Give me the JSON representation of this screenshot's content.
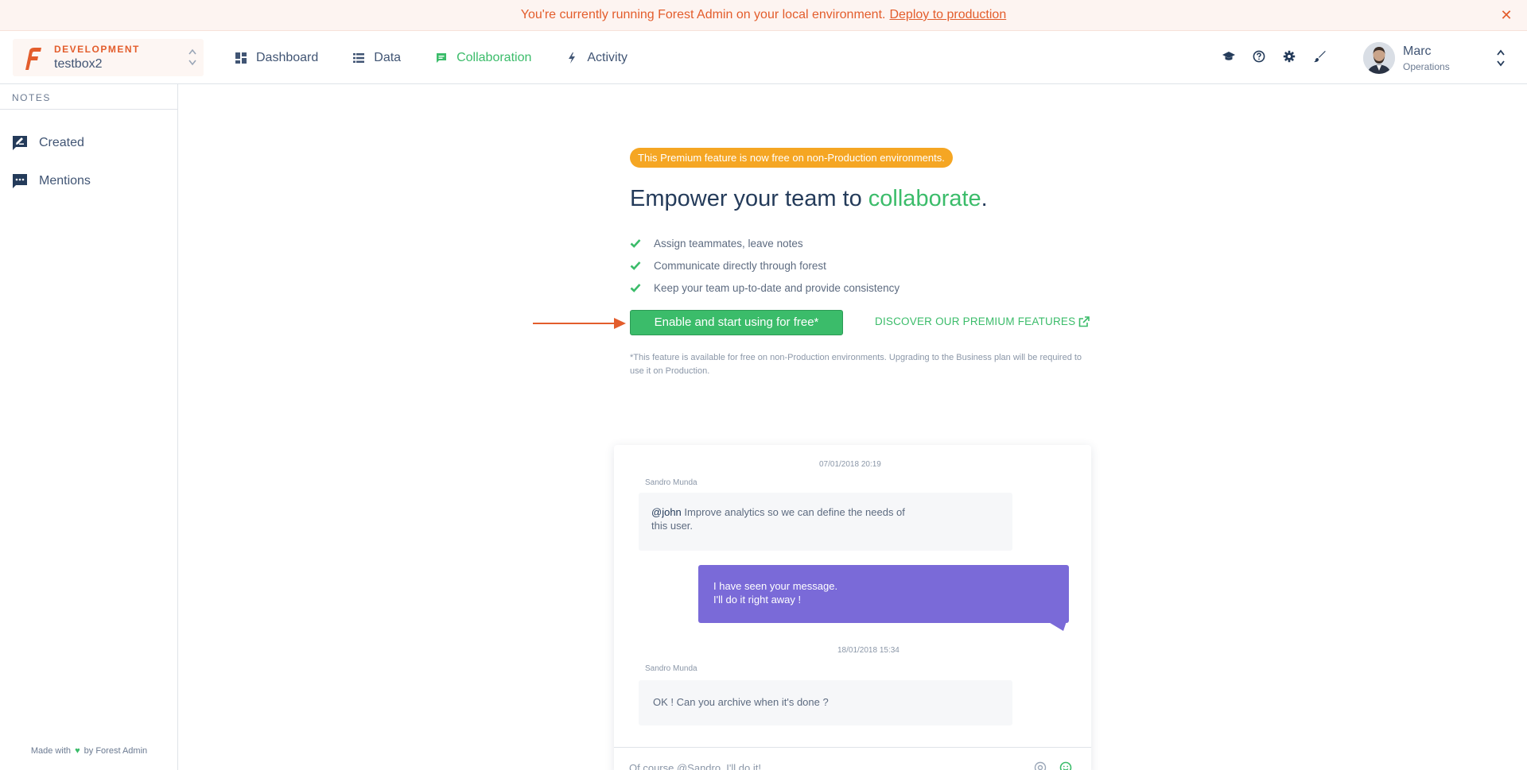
{
  "banner": {
    "message": "You're currently running Forest Admin on your local environment.",
    "link": "Deploy to production",
    "close_glyph": "✕"
  },
  "header": {
    "environment": {
      "label": "DEVELOPMENT",
      "name": "testbox2"
    },
    "nav": [
      {
        "label": "Dashboard",
        "icon": "dashboard-icon"
      },
      {
        "label": "Data",
        "icon": "list-icon"
      },
      {
        "label": "Collaboration",
        "icon": "chat-icon",
        "active": true
      },
      {
        "label": "Activity",
        "icon": "bolt-icon"
      }
    ],
    "tools": [
      "graduation-cap-icon",
      "help-icon",
      "gear-icon",
      "brush-icon"
    ],
    "user": {
      "name": "Marc",
      "role": "Operations"
    }
  },
  "sidebar": {
    "heading": "NOTES",
    "items": [
      {
        "label": "Created",
        "icon": "note-edit-icon"
      },
      {
        "label": "Mentions",
        "icon": "comment-icon"
      }
    ],
    "footer": {
      "prefix": "Made with",
      "suffix": "by Forest Admin"
    }
  },
  "main": {
    "badge": "This Premium feature is now free on non-Production environments.",
    "headline": {
      "before": "Empower your team to",
      "accent": "collaborate",
      "after": "."
    },
    "features": [
      "Assign teammates, leave notes",
      "Communicate directly through forest",
      "Keep your team up-to-date and provide consistency"
    ],
    "cta": "Enable and start using for free*",
    "premium_link": "DISCOVER OUR PREMIUM FEATURES",
    "footnote": "*This feature is available for free on non-Production environments. Upgrading to the Business plan will be required to use it on Production."
  },
  "preview": {
    "thread": [
      {
        "timestamp": "07/01/2018 20:19",
        "author": "Sandro Munda",
        "mention": "@john",
        "text": "Improve analytics so we can define the needs of this user."
      },
      {
        "reply_line1": "I have seen your message.",
        "reply_line2": "I'll do it right away !"
      },
      {
        "timestamp": "18/01/2018 15:34",
        "author": "Sandro Munda",
        "text": "OK ! Can you archive when it's done ?"
      }
    ],
    "composer_text": "Of course @Sandro, I'll do it!"
  },
  "colors": {
    "accent_green": "#3bbc6a",
    "brand_orange": "#e35d2c",
    "badge_amber": "#f5a623",
    "bubble_purple": "#7a6ad8"
  }
}
